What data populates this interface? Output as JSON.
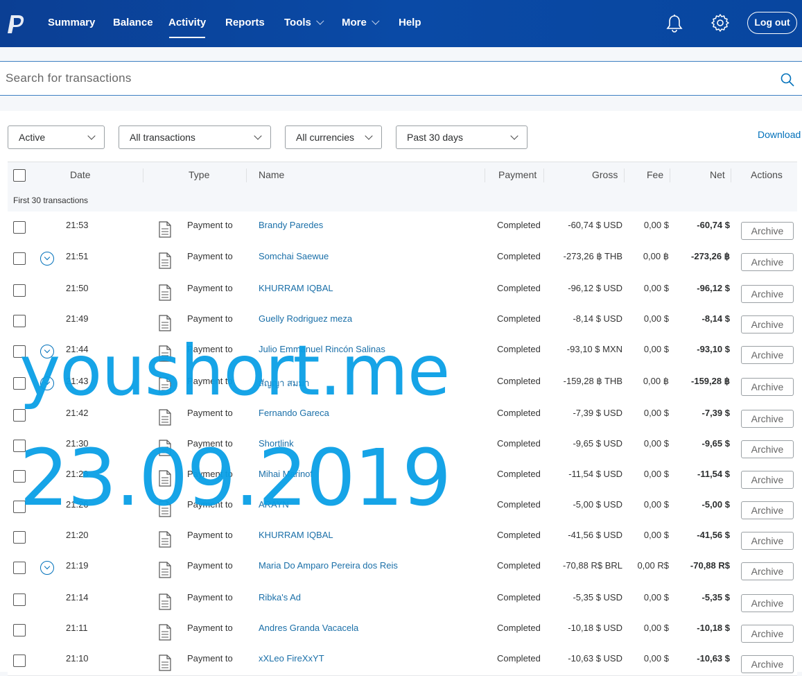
{
  "nav": {
    "items": [
      {
        "label": "Summary"
      },
      {
        "label": "Balance"
      },
      {
        "label": "Activity"
      },
      {
        "label": "Reports"
      },
      {
        "label": "Tools"
      },
      {
        "label": "More"
      },
      {
        "label": "Help"
      }
    ],
    "active": "Activity",
    "logout_label": "Log out",
    "brand_color": "#0b3f94"
  },
  "search": {
    "placeholder": "Search for transactions",
    "value": ""
  },
  "filters": {
    "status": "Active",
    "transactions": "All transactions",
    "currencies": "All currencies",
    "period": "Past 30 days",
    "download_label": "Download"
  },
  "table": {
    "headers": {
      "date": "Date",
      "type": "Type",
      "name": "Name",
      "payment": "Payment",
      "gross": "Gross",
      "fee": "Fee",
      "net": "Net",
      "actions": "Actions"
    },
    "group_label": "First 30 transactions",
    "archive_label": "Archive",
    "rows": [
      {
        "time": "21:53",
        "type": "Payment to",
        "name": "Brandy Paredes",
        "status": "Completed",
        "gross": "-60,74 $ USD",
        "fee": "0,00 $",
        "net": "-60,74 $"
      },
      {
        "time": "21:51",
        "type": "Payment to",
        "name": "Somchai Saewue",
        "status": "Completed",
        "gross": "-273,26 ฿ THB",
        "fee": "0,00 ฿",
        "net": "-273,26 ฿"
      },
      {
        "time": "21:50",
        "type": "Payment to",
        "name": "KHURRAM IQBAL",
        "status": "Completed",
        "gross": "-96,12 $ USD",
        "fee": "0,00 $",
        "net": "-96,12 $"
      },
      {
        "time": "21:49",
        "type": "Payment to",
        "name": "Guelly Rodriguez meza",
        "status": "Completed",
        "gross": "-8,14 $ USD",
        "fee": "0,00 $",
        "net": "-8,14 $"
      },
      {
        "time": "21:44",
        "type": "Payment to",
        "name": "Julio Emmanuel Rincón Salinas",
        "status": "Completed",
        "gross": "-93,10 $ MXN",
        "fee": "0,00 $",
        "net": "-93,10 $"
      },
      {
        "time": "21:43",
        "type": "Payment to",
        "name": "สัญญา สมมา",
        "status": "Completed",
        "gross": "-159,28 ฿ THB",
        "fee": "0,00 ฿",
        "net": "-159,28 ฿"
      },
      {
        "time": "21:42",
        "type": "Payment to",
        "name": "Fernando Gareca",
        "status": "Completed",
        "gross": "-7,39 $ USD",
        "fee": "0,00 $",
        "net": "-7,39 $"
      },
      {
        "time": "21:30",
        "type": "Payment to",
        "name": "Shortlink",
        "status": "Completed",
        "gross": "-9,65 $ USD",
        "fee": "0,00 $",
        "net": "-9,65 $"
      },
      {
        "time": "21:28",
        "type": "Payment to",
        "name": "Mihai Marinof",
        "status": "Completed",
        "gross": "-11,54 $ USD",
        "fee": "0,00 $",
        "net": "-11,54 $"
      },
      {
        "time": "21:26",
        "type": "Payment to",
        "name": "ARAYN",
        "status": "Completed",
        "gross": "-5,00 $ USD",
        "fee": "0,00 $",
        "net": "-5,00 $"
      },
      {
        "time": "21:20",
        "type": "Payment to",
        "name": "KHURRAM IQBAL",
        "status": "Completed",
        "gross": "-41,56 $ USD",
        "fee": "0,00 $",
        "net": "-41,56 $"
      },
      {
        "time": "21:19",
        "type": "Payment to",
        "name": "Maria Do Amparo Pereira dos Reis",
        "status": "Completed",
        "gross": "-70,88 R$ BRL",
        "fee": "0,00 R$",
        "net": "-70,88 R$"
      },
      {
        "time": "21:14",
        "type": "Payment to",
        "name": "Ribka's Ad",
        "status": "Completed",
        "gross": "-5,35 $ USD",
        "fee": "0,00 $",
        "net": "-5,35 $"
      },
      {
        "time": "21:11",
        "type": "Payment to",
        "name": "Andres Granda Vacacela",
        "status": "Completed",
        "gross": "-10,18 $ USD",
        "fee": "0,00 $",
        "net": "-10,18 $"
      },
      {
        "time": "21:10",
        "type": "Payment to",
        "name": "xXLeo FireXxYT",
        "status": "Completed",
        "gross": "-10,63 $ USD",
        "fee": "0,00 $",
        "net": "-10,63 $"
      }
    ]
  },
  "watermark": {
    "line1": "youshort.me",
    "line2": "23.09.2019",
    "color": "#0aa0e6"
  }
}
